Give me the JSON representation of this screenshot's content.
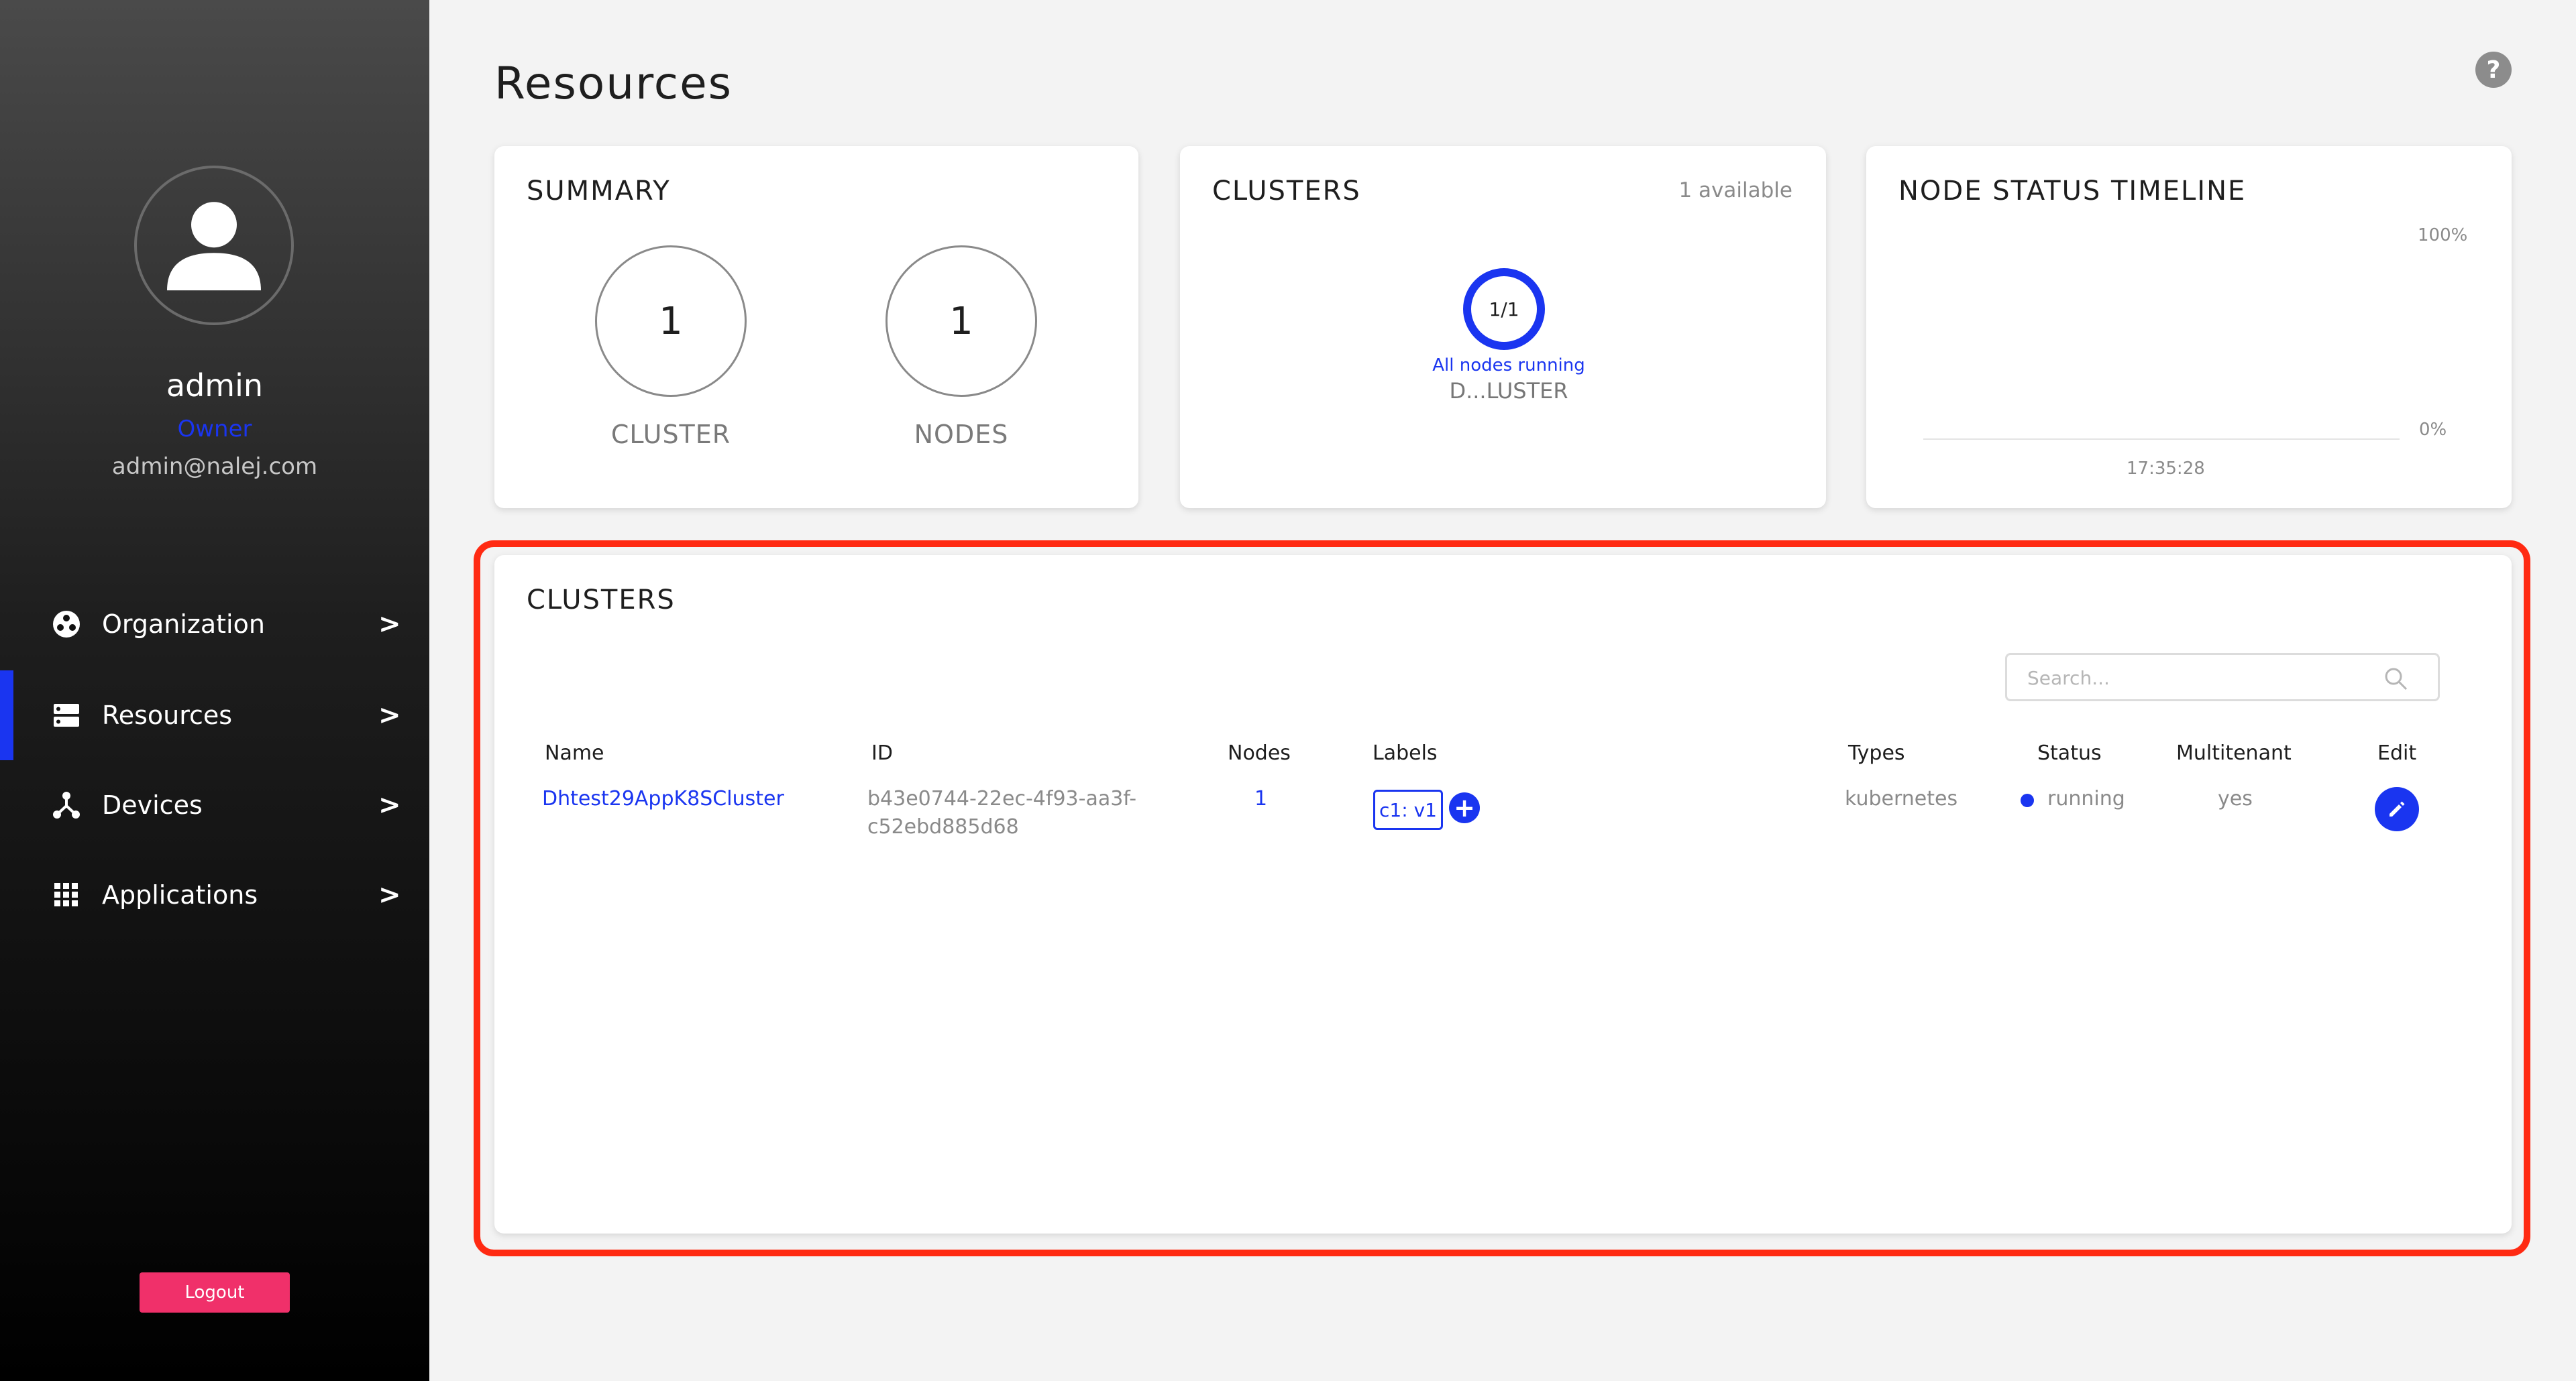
{
  "sidebar": {
    "user": {
      "name": "admin",
      "role": "Owner",
      "email": "admin@nalej.com"
    },
    "nav": [
      {
        "label": "Organization",
        "icon": "organization-icon",
        "chevron": ">"
      },
      {
        "label": "Resources",
        "icon": "resources-icon",
        "chevron": ">",
        "active": true
      },
      {
        "label": "Devices",
        "icon": "devices-icon",
        "chevron": ">"
      },
      {
        "label": "Applications",
        "icon": "applications-icon",
        "chevron": ">"
      }
    ],
    "logout_label": "Logout"
  },
  "page": {
    "title": "Resources",
    "help_icon": "?"
  },
  "summary": {
    "title": "SUMMARY",
    "stats": [
      {
        "value": "1",
        "label": "CLUSTER"
      },
      {
        "value": "1",
        "label": "NODES"
      }
    ]
  },
  "clusters_overview": {
    "title": "CLUSTERS",
    "available": "1 available",
    "donut": {
      "value": "1/1",
      "status": "All nodes running",
      "name": "D...LUSTER"
    }
  },
  "node_status_timeline": {
    "title": "NODE STATUS TIMELINE",
    "y_max_label": "100%",
    "y_min_label": "0%",
    "x_label": "17:35:28"
  },
  "clusters_table": {
    "title": "CLUSTERS",
    "search_placeholder": "Search...",
    "columns": [
      "Name",
      "ID",
      "Nodes",
      "Labels",
      "Types",
      "Status",
      "Multitenant",
      "Edit"
    ],
    "rows": [
      {
        "name": "Dhtest29AppK8SCluster",
        "id_line1": "b43e0744-22ec-4f93-aa3f-",
        "id_line2": "c52ebd885d68",
        "nodes": "1",
        "label": "c1: v1",
        "add_label": "+",
        "type": "kubernetes",
        "status": "running",
        "status_color": "#1a35f0",
        "multitenant": "yes"
      }
    ]
  },
  "colors": {
    "accent": "#1a35f0",
    "logout": "#f0306a",
    "highlight": "#ff2a12"
  }
}
